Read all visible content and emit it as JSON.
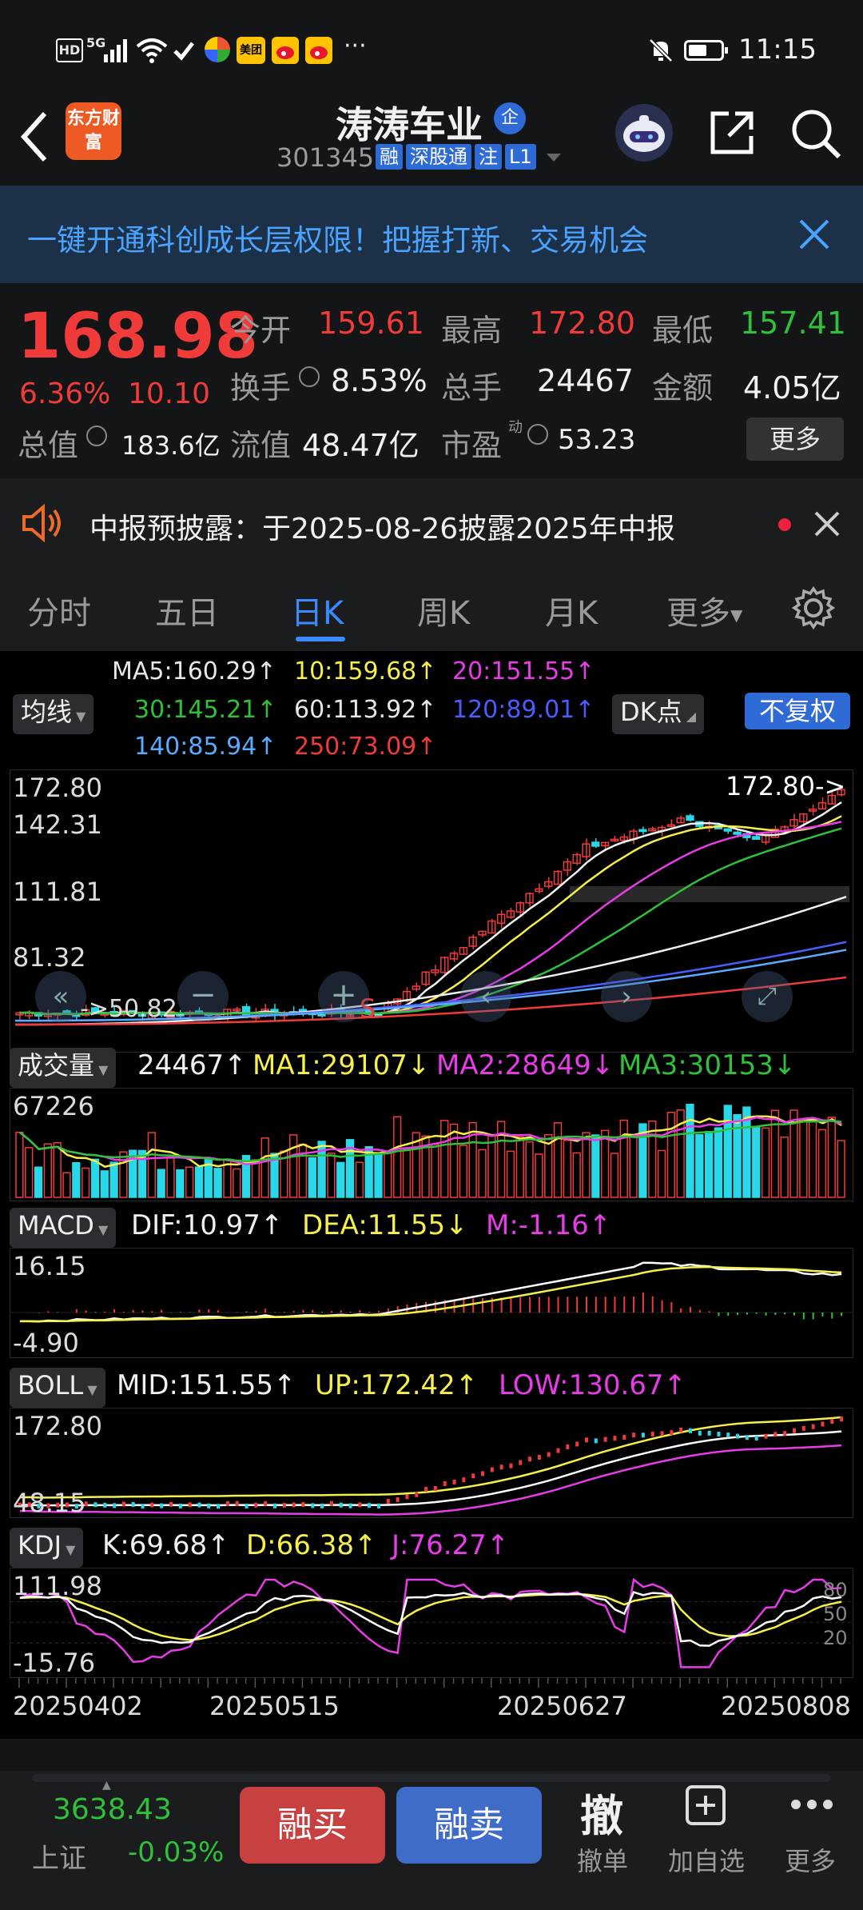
{
  "status_bar": {
    "left_icons": [
      "hd-icon",
      "5g-signal-icon",
      "wifi-icon",
      "app-icon-1",
      "app-icon-2",
      "meituan-icon",
      "weibo-icon",
      "weibo-icon-2",
      "more-dots-icon"
    ],
    "network": "5G",
    "meituan_label": "美团",
    "more": "···",
    "time": "11:15"
  },
  "header": {
    "logo_text": "东方财富",
    "stock_name": "涛涛车业",
    "company_badge": "企",
    "stock_code": "301345",
    "tags": [
      "融",
      "深股通",
      "注",
      "L1"
    ]
  },
  "banner": {
    "text": "一键开通科创成长层权限！把握打新、交易机会"
  },
  "quote": {
    "price": "168.98",
    "change_pct": "6.36%",
    "change_amt": "10.10",
    "open_label": "今开",
    "open": "159.61",
    "high_label": "最高",
    "high": "172.80",
    "low_label": "最低",
    "low": "157.41",
    "turnover_label": "换手",
    "turnover": "8.53%",
    "volume_label": "总手",
    "volume": "24467",
    "amount_label": "金额",
    "amount": "4.05亿",
    "mktcap_label": "总值",
    "mktcap": "183.6亿",
    "float_label": "流值",
    "float_cap": "48.47亿",
    "pe_label": "市盈",
    "pe_sup": "动",
    "pe": "53.23",
    "more_label": "更多"
  },
  "notice": {
    "text": "中报预披露：于2025-08-26披露2025年中报"
  },
  "tabs": {
    "items": [
      "分时",
      "五日",
      "日K",
      "周K",
      "月K",
      "更多"
    ],
    "active": "日K"
  },
  "ma_panel": {
    "selector": "均线",
    "dk_label": "DK点",
    "fq_label": "不复权",
    "items": [
      {
        "text": "MA5:160.29↑",
        "color": "#f0f0f0"
      },
      {
        "text": "10:159.68↑",
        "color": "#f6f04a"
      },
      {
        "text": "20:151.55↑",
        "color": "#e83ce8"
      },
      {
        "text": "30:145.21↑",
        "color": "#2fc13a"
      },
      {
        "text": "60:113.92↑",
        "color": "#f0f0f0"
      },
      {
        "text": "120:89.01↑",
        "color": "#4a5cff"
      },
      {
        "text": "140:85.94↑",
        "color": "#5aaaff"
      },
      {
        "text": "250:73.09↑",
        "color": "#f03b3b"
      }
    ]
  },
  "kline": {
    "y_labels": [
      "172.80",
      "142.31",
      "111.81",
      "81.32",
      "50.82"
    ],
    "high_marker": "172.80->",
    "low_marker": "50.82",
    "s_marker": "S"
  },
  "volume_panel": {
    "selector": "成交量",
    "value": "24467↑",
    "ma1": "MA1:29107↓",
    "ma2": "MA2:28649↓",
    "ma3": "MA3:30153↓",
    "y_label": "67226"
  },
  "macd_panel": {
    "selector": "MACD",
    "dif": "DIF:10.97↑",
    "dea": "DEA:11.55↓",
    "m": "M:-1.16↑",
    "y_top": "16.15",
    "y_bottom": "-4.90"
  },
  "boll_panel": {
    "selector": "BOLL",
    "mid": "MID:151.55↑",
    "up": "UP:172.42↑",
    "low": "LOW:130.67↑",
    "y_top": "172.80",
    "y_bottom": "48.15"
  },
  "kdj_panel": {
    "selector": "KDJ",
    "k": "K:69.68↑",
    "d": "D:66.38↑",
    "j": "J:76.27↑",
    "y_top": "111.98",
    "y_bottom": "-15.76",
    "levels": [
      "80",
      "50",
      "20"
    ]
  },
  "dates": [
    "20250402",
    "20250515",
    "20250627",
    "20250808"
  ],
  "bottom_bar": {
    "index_value": "3638.43",
    "index_name": "上证",
    "index_change": "-0.03%",
    "buy_label": "融买",
    "sell_label": "融卖",
    "cancel_big": "撤",
    "cancel_label": "撤单",
    "add_label": "加自选",
    "more_label": "更多"
  },
  "colors": {
    "up": "#f03b3b",
    "down": "#2fc13a",
    "accent": "#2f6bd6",
    "ma5": "#f0f0f0",
    "ma10": "#f6f04a",
    "ma20": "#e83ce8",
    "ma30": "#2fc13a",
    "ma60": "#f0f0f0",
    "ma120": "#4a5cff",
    "ma250": "#f03b3b"
  }
}
